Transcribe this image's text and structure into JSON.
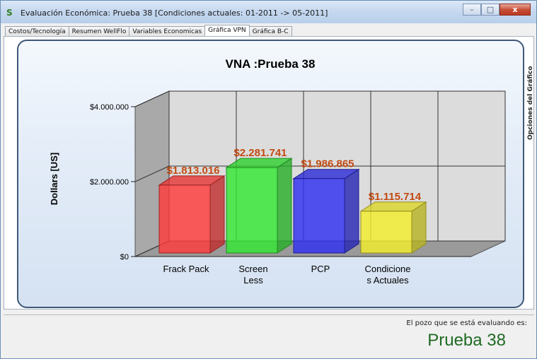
{
  "window": {
    "title": "Evaluación Económica: Prueba 38 [Condiciones actuales: 01-2011 -> 05-2011]",
    "app_icon": "S",
    "minimize_glyph": "–",
    "maximize_glyph": "□",
    "close_glyph": "x"
  },
  "tabs": [
    {
      "label": "Costos/Tecnología"
    },
    {
      "label": "Resumen WellFlo"
    },
    {
      "label": "Variables Economicas"
    },
    {
      "label": "Gráfica VPN"
    },
    {
      "label": "Gráfica B-C"
    }
  ],
  "active_tab": "Gráfica VPN",
  "side_tab_label": "Opciones del Gráfico",
  "status": {
    "label": "El pozo que se está evaluando es:",
    "value": "Prueba 38"
  },
  "chart_data": {
    "type": "bar",
    "title": "VNA :Prueba 38",
    "ylabel": "Dollars [US]",
    "xlabel": "",
    "ylim": [
      0,
      4000000
    ],
    "yticks": [
      0,
      2000000,
      4000000
    ],
    "ytick_labels": [
      "$0",
      "$2.000.000",
      "$4.000.000"
    ],
    "categories": [
      [
        "Frack Pack"
      ],
      [
        "Screen",
        "Less"
      ],
      [
        "PCP"
      ],
      [
        "Condicione",
        "s Actuales"
      ]
    ],
    "values": [
      1813016,
      2281741,
      1986865,
      1115714
    ],
    "value_labels": [
      "$1.813.016",
      "$2.281.741",
      "$1.986.865",
      "$1.115.714"
    ],
    "colors": [
      "#ff3b3b",
      "#33e833",
      "#3030f0",
      "#f4ee2c"
    ],
    "label_color": "#c24a12",
    "grid": true,
    "three_d": true
  }
}
